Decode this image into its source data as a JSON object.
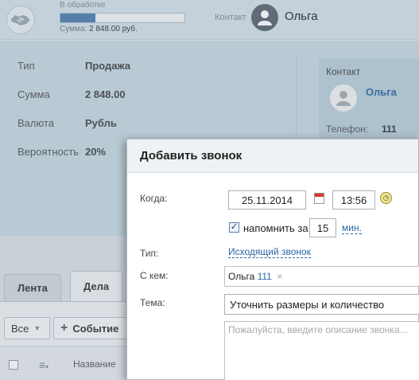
{
  "header": {
    "stage_label": "В обработке",
    "progress": 0.28,
    "sum_label": "Сумма:",
    "sum_value": "2 848.00 руб.",
    "contact_label": "Контакт",
    "contact_name": "Ольга"
  },
  "details": {
    "fields": [
      {
        "label": "Тип",
        "value": "Продажа"
      },
      {
        "label": "Сумма",
        "value": "2 848.00"
      },
      {
        "label": "Валюта",
        "value": "Рубль"
      },
      {
        "label": "Вероятность",
        "value": "20%"
      }
    ],
    "contact_card": {
      "title": "Контакт",
      "name": "Ольга",
      "phone_label": "Телефон:",
      "phone": "111"
    }
  },
  "tabs": [
    {
      "label": "Лента"
    },
    {
      "label": "Дела"
    }
  ],
  "toolbar": {
    "filter_label": "Все",
    "add_event_label": "Событие"
  },
  "grid": {
    "column_name": "Название"
  },
  "dialog": {
    "title": "Добавить звонок",
    "when_label": "Когда:",
    "date": "25.11.2014",
    "time": "13:56",
    "remind_checked": true,
    "remind_label": "напомнить за",
    "remind_value": "15",
    "remind_unit": "мин.",
    "type_label": "Тип:",
    "type_value": "Исходящий звонок",
    "with_label": "С кем:",
    "with_name": "Ольга",
    "with_phone": "111",
    "subject_label": "Тема:",
    "subject_value": "Уточнить размеры и количество",
    "description_placeholder": "Пожалуйста, введите описание звонка..."
  },
  "colors": {
    "accent": "#2a64a8",
    "progress_fill": "#4d7dae"
  }
}
